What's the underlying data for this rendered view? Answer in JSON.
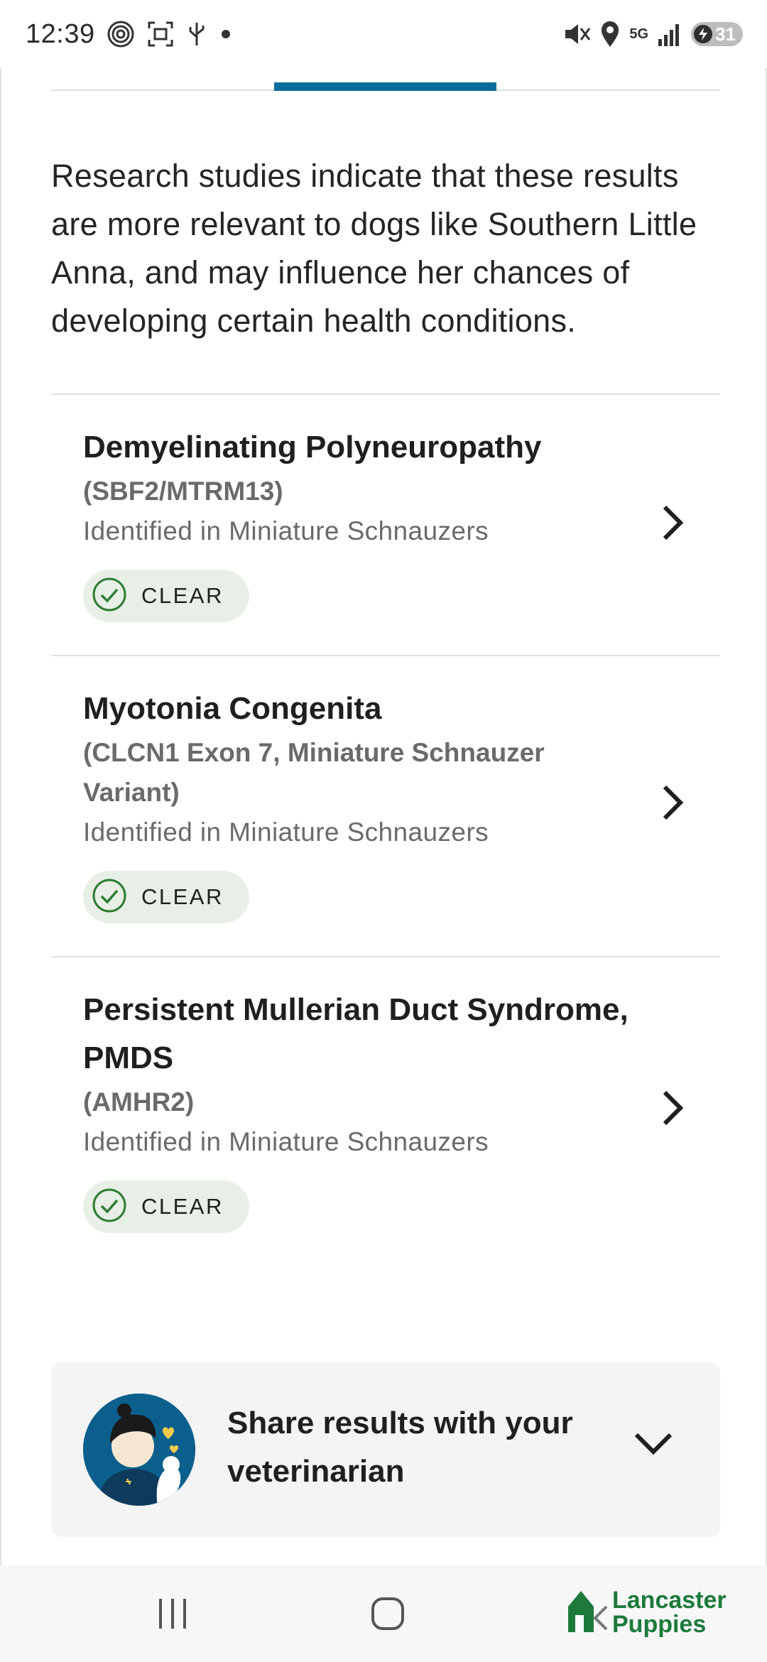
{
  "status_bar": {
    "time": "12:39",
    "network": "5G",
    "battery": "31",
    "icons": [
      "fingerprint-icon",
      "screen-record-icon",
      "usb-icon",
      "dot-icon",
      "mute-icon",
      "location-icon",
      "signal-icon",
      "battery-icon"
    ]
  },
  "intro": {
    "text": "Research studies indicate that these results are more relevant to dogs like Southern Little Anna, and may influence her chances of developing certain health conditions."
  },
  "conditions": [
    {
      "title": "Demyelinating Polyneuropathy",
      "gene": "(SBF2/MTRM13)",
      "breed": "Identified in Miniature Schnauzers",
      "status": "CLEAR"
    },
    {
      "title": "Myotonia Congenita",
      "gene": "(CLCN1 Exon 7, Miniature Schnauzer Variant)",
      "breed": "Identified in Miniature Schnauzers",
      "status": "CLEAR"
    },
    {
      "title": "Persistent Mullerian Duct Syndrome, PMDS",
      "gene": "(AMHR2)",
      "breed": "Identified in Miniature Schnauzers",
      "status": "CLEAR"
    }
  ],
  "share": {
    "label": "Share results with your veterinarian"
  },
  "logo": {
    "line1": "Lancaster",
    "line2": "Puppies"
  },
  "colors": {
    "accent": "#0a6c9a",
    "clear_green": "#2e7d32",
    "chip_bg": "#e8efe6",
    "logo_green": "#1d7a3a"
  }
}
